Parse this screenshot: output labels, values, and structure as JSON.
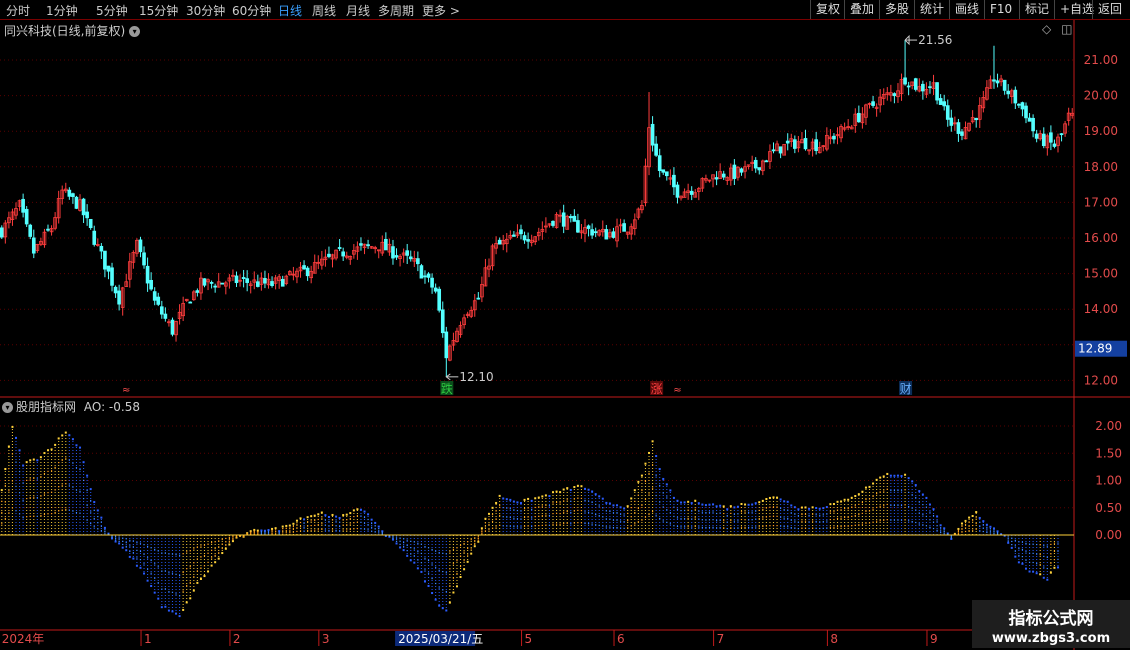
{
  "toolbar": {
    "tabs": [
      "分时",
      "1分钟",
      "5分钟",
      "15分钟",
      "30分钟",
      "60分钟",
      "日线",
      "周线",
      "月线",
      "多周期",
      "更多"
    ],
    "active_tab": "日线",
    "more_arrow": ">",
    "right_buttons": [
      "复权",
      "叠加",
      "多股",
      "统计",
      "画线",
      "F10",
      "标记",
      "+自选",
      "返回"
    ]
  },
  "main_panel": {
    "title": "同兴科技(日线,前复权)",
    "current_price_tag": "12.89",
    "high_marker": "21.56",
    "low_marker": "12.10",
    "event_labels": [
      {
        "text": "跌",
        "color": "#2ecc40",
        "bg": "#0b4d1b",
        "index": 125
      },
      {
        "text": "涨",
        "color": "#ff4040",
        "bg": "#5a0a0a",
        "index": 184
      },
      {
        "text": "财",
        "color": "#6ab0ff",
        "bg": "#0b2d5a",
        "index": 254
      }
    ],
    "small_markers": [
      {
        "text": "≈",
        "index": 35
      },
      {
        "text": "≈",
        "index": 190
      }
    ]
  },
  "indicator_panel": {
    "title": "股朋指标网",
    "value_label": "AO: -0.58"
  },
  "watermark": {
    "line1": "指标公式网",
    "line2": "www.zbgs3.com"
  },
  "chart_data": [
    {
      "type": "candlestick",
      "title": "同兴科技(日线,前复权)",
      "y_ticks": [
        "21.00",
        "20.00",
        "19.00",
        "18.00",
        "17.00",
        "16.00",
        "15.00",
        "14.00",
        "12.00"
      ],
      "ylim": [
        11.6,
        22.2
      ],
      "x_labels": [
        "2024年",
        "1",
        "2",
        "3",
        "2025/03/21/五",
        "5",
        "6",
        "7",
        "8",
        "9"
      ],
      "x_label_index": [
        0,
        40,
        65,
        90,
        112,
        147,
        173,
        201,
        233,
        261
      ],
      "keypoints": [
        [
          0,
          16.2
        ],
        [
          5,
          16.9
        ],
        [
          9,
          15.6
        ],
        [
          14,
          16.3
        ],
        [
          17,
          17.3
        ],
        [
          22,
          16.9
        ],
        [
          28,
          15.5
        ],
        [
          33,
          14.3
        ],
        [
          38,
          15.8
        ],
        [
          43,
          14.2
        ],
        [
          48,
          13.4
        ],
        [
          52,
          14.2
        ],
        [
          56,
          14.7
        ],
        [
          66,
          14.8
        ],
        [
          76,
          14.7
        ],
        [
          86,
          15.1
        ],
        [
          96,
          15.6
        ],
        [
          106,
          15.8
        ],
        [
          116,
          15.3
        ],
        [
          122,
          14.5
        ],
        [
          125,
          12.7
        ],
        [
          130,
          13.9
        ],
        [
          134,
          14.3
        ],
        [
          138,
          15.7
        ],
        [
          144,
          16.0
        ],
        [
          150,
          16.1
        ],
        [
          156,
          16.6
        ],
        [
          162,
          16.3
        ],
        [
          170,
          16.1
        ],
        [
          176,
          16.3
        ],
        [
          180,
          16.9
        ],
        [
          182,
          19.1
        ],
        [
          185,
          17.9
        ],
        [
          190,
          17.3
        ],
        [
          195,
          17.4
        ],
        [
          201,
          17.8
        ],
        [
          206,
          17.8
        ],
        [
          212,
          18.0
        ],
        [
          218,
          18.5
        ],
        [
          224,
          18.7
        ],
        [
          230,
          18.6
        ],
        [
          236,
          19.0
        ],
        [
          242,
          19.5
        ],
        [
          247,
          19.9
        ],
        [
          251,
          20.1
        ],
        [
          254,
          20.5
        ],
        [
          258,
          20.2
        ],
        [
          262,
          20.3
        ],
        [
          266,
          19.3
        ],
        [
          270,
          19.0
        ],
        [
          275,
          19.6
        ],
        [
          279,
          20.5
        ],
        [
          284,
          20.0
        ],
        [
          288,
          19.5
        ],
        [
          291,
          18.8
        ],
        [
          294,
          18.7
        ],
        [
          296,
          18.6
        ],
        [
          298,
          18.9
        ],
        [
          300,
          19.4
        ]
      ],
      "high": 21.56,
      "low": 12.1,
      "last": 12.89
    },
    {
      "type": "bar",
      "name": "AO",
      "y_ticks": [
        "2.00",
        "1.50",
        "1.00",
        "0.50",
        "0.00"
      ],
      "ylim": [
        -1.7,
        2.3
      ],
      "keypoints": [
        [
          0,
          0.8
        ],
        [
          3,
          2.0
        ],
        [
          6,
          1.3
        ],
        [
          10,
          1.4
        ],
        [
          14,
          1.6
        ],
        [
          18,
          1.9
        ],
        [
          22,
          1.6
        ],
        [
          26,
          0.6
        ],
        [
          30,
          0.0
        ],
        [
          35,
          -0.3
        ],
        [
          40,
          -0.7
        ],
        [
          45,
          -1.3
        ],
        [
          50,
          -1.5
        ],
        [
          55,
          -0.9
        ],
        [
          60,
          -0.5
        ],
        [
          65,
          -0.1
        ],
        [
          72,
          0.1
        ],
        [
          78,
          0.1
        ],
        [
          84,
          0.3
        ],
        [
          90,
          0.4
        ],
        [
          95,
          0.3
        ],
        [
          100,
          0.5
        ],
        [
          104,
          0.3
        ],
        [
          108,
          0.0
        ],
        [
          112,
          -0.2
        ],
        [
          118,
          -0.7
        ],
        [
          122,
          -1.2
        ],
        [
          125,
          -1.4
        ],
        [
          130,
          -0.6
        ],
        [
          134,
          -0.1
        ],
        [
          136,
          0.3
        ],
        [
          140,
          0.7
        ],
        [
          146,
          0.6
        ],
        [
          152,
          0.7
        ],
        [
          157,
          0.8
        ],
        [
          163,
          0.9
        ],
        [
          170,
          0.6
        ],
        [
          176,
          0.5
        ],
        [
          180,
          1.1
        ],
        [
          183,
          1.7
        ],
        [
          186,
          1.0
        ],
        [
          190,
          0.6
        ],
        [
          196,
          0.6
        ],
        [
          204,
          0.5
        ],
        [
          212,
          0.6
        ],
        [
          218,
          0.7
        ],
        [
          224,
          0.5
        ],
        [
          230,
          0.5
        ],
        [
          236,
          0.6
        ],
        [
          242,
          0.8
        ],
        [
          248,
          1.1
        ],
        [
          254,
          1.1
        ],
        [
          260,
          0.7
        ],
        [
          264,
          0.2
        ],
        [
          267,
          -0.1
        ],
        [
          270,
          0.2
        ],
        [
          274,
          0.4
        ],
        [
          277,
          0.2
        ],
        [
          282,
          0.0
        ],
        [
          286,
          -0.5
        ],
        [
          290,
          -0.7
        ],
        [
          294,
          -0.8
        ],
        [
          296,
          -0.58
        ]
      ],
      "last": -0.58
    }
  ],
  "colors": {
    "up": "#ff3d3d",
    "down": "#54ffff",
    "grid": "#5a0000",
    "axis": "#c21a1a",
    "ao_pos": "#ffd23a",
    "ao_neg": "#2a5cff",
    "price_tag": "#1440a0"
  }
}
